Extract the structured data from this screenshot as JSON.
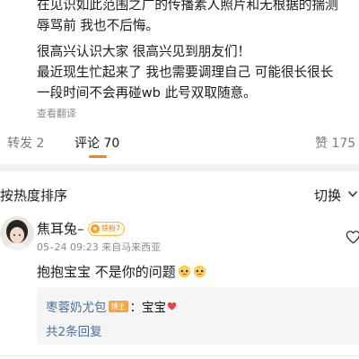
{
  "post": {
    "lines": [
      "在见识如此范围之广的传播素人照片和无根据的揣测",
      "辱骂前 我也不后悔。",
      "很高兴认识大家 很高兴见到朋友们！",
      "最近现生忙起来了 我也需要调理自己 可能很长很长",
      "一段时间不会再碰wb 此号双取随意。"
    ],
    "translate_link": "查看翻译"
  },
  "tabs": {
    "repost": "转发 2",
    "comment": "评论 70",
    "like": "赞 175",
    "accent_color": "#ff8200"
  },
  "sort": {
    "label": "按热度排序",
    "switch_label": "切换"
  },
  "comment": {
    "username": "焦耳兔–",
    "fan_badge": "铁粉7",
    "meta": "05–24 09:23 来自马来西亚",
    "text": "抱抱宝宝 不是你的问题",
    "emoji_icons": [
      "pleading-face-icon",
      "pleading-face-icon"
    ],
    "reply": {
      "user": "枣蓉奶尤包",
      "author_badge": "博主",
      "separator": "：",
      "text": "宝宝",
      "count_label": "共2条回复"
    }
  },
  "colors": {
    "link_blue": "#4a6f9c",
    "badge_orange": "#f4a640"
  }
}
